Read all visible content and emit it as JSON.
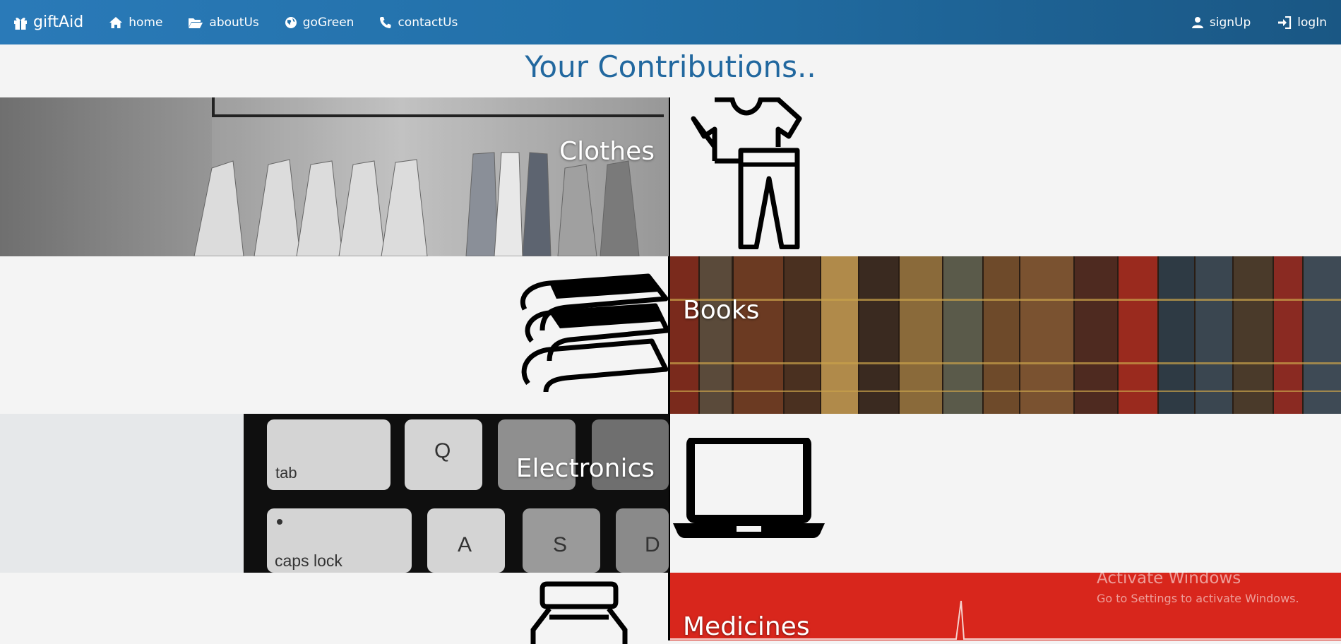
{
  "navbar": {
    "brand": "giftAid",
    "links": [
      "home",
      "aboutUs",
      "goGreen",
      "contactUs"
    ],
    "right_links": [
      "signUp",
      "logIn"
    ],
    "icons": {
      "brand": "gift-icon",
      "home": "home-icon",
      "aboutUs": "folder-open-icon",
      "goGreen": "globe-icon",
      "contactUs": "phone-icon",
      "signUp": "user-icon",
      "logIn": "log-in-icon"
    }
  },
  "page": {
    "title": "Your Contributions.."
  },
  "categories": [
    {
      "label": "Clothes",
      "icon": "clothes-icon"
    },
    {
      "label": "Books",
      "icon": "books-icon"
    },
    {
      "label": "Electronics",
      "icon": "laptop-icon"
    },
    {
      "label": "Medicines",
      "icon": "medicine-bottle-icon"
    }
  ],
  "watermark": {
    "title": "Activate Windows",
    "subtitle": "Go to Settings to activate Windows."
  },
  "colors": {
    "navbar": "#2270a8",
    "title": "#22689f",
    "medicines_bg": "#d8261c",
    "background": "#f4f4f4"
  }
}
